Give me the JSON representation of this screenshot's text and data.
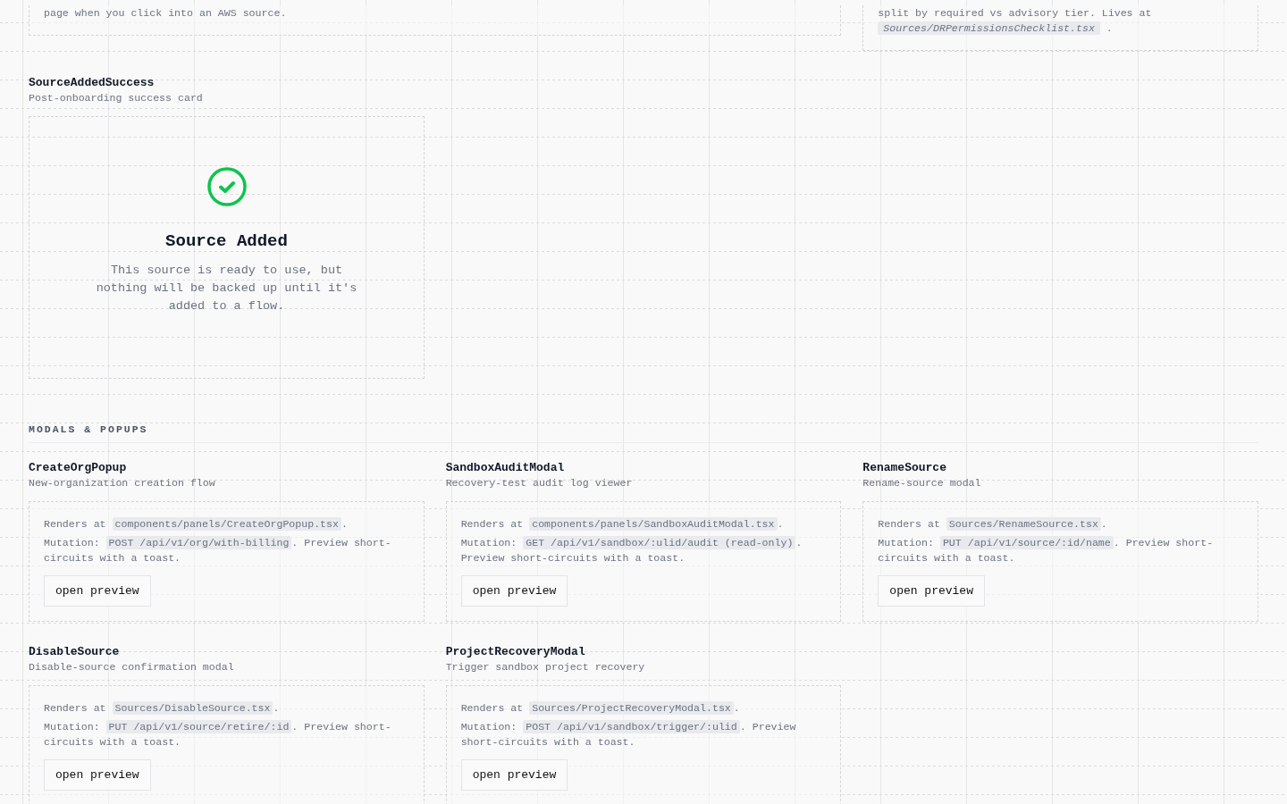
{
  "partial_cards": [
    {
      "wide": true,
      "paragraphs": [
        [
          {
            "kind": "text",
            "text": "page when you click into an AWS source."
          }
        ]
      ]
    },
    {
      "wide": false,
      "paragraphs": [
        [
          {
            "kind": "text",
            "text": "split by required vs advisory tier. Lives at "
          },
          {
            "kind": "italic_code",
            "text": "Sources/DRPermissionsChecklist.tsx"
          },
          {
            "kind": "text",
            "text": " ."
          }
        ]
      ]
    }
  ],
  "success_preview": {
    "name": "SourceAddedSuccess",
    "description": "Post-onboarding success card",
    "card": {
      "title": "Source Added",
      "message": "This source is ready to use, but nothing will be backed up until it's added to a flow."
    }
  },
  "modals_section": {
    "heading": "MODALS & POPUPS",
    "components": [
      {
        "name": "CreateOrgPopup",
        "description": "New-organization creation flow",
        "paragraphs": [
          [
            {
              "kind": "text",
              "text": "Renders at "
            },
            {
              "kind": "code",
              "text": "components/panels/CreateOrgPopup.tsx"
            },
            {
              "kind": "text",
              "text": "."
            }
          ],
          [
            {
              "kind": "text",
              "text": "Mutation: "
            },
            {
              "kind": "code",
              "text": "POST /api/v1/org/with-billing"
            },
            {
              "kind": "text",
              "text": ". Preview short-circuits with a toast."
            }
          ]
        ],
        "button": "open preview"
      },
      {
        "name": "SandboxAuditModal",
        "description": "Recovery-test audit log viewer",
        "paragraphs": [
          [
            {
              "kind": "text",
              "text": "Renders at "
            },
            {
              "kind": "code",
              "text": "components/panels/SandboxAuditModal.tsx"
            },
            {
              "kind": "text",
              "text": "."
            }
          ],
          [
            {
              "kind": "text",
              "text": "Mutation: "
            },
            {
              "kind": "code",
              "text": "GET /api/v1/sandbox/:ulid/audit (read-only)"
            },
            {
              "kind": "text",
              "text": ". Preview short-circuits with a toast."
            }
          ]
        ],
        "button": "open preview"
      },
      {
        "name": "RenameSource",
        "description": "Rename-source modal",
        "paragraphs": [
          [
            {
              "kind": "text",
              "text": "Renders at "
            },
            {
              "kind": "code",
              "text": "Sources/RenameSource.tsx"
            },
            {
              "kind": "text",
              "text": "."
            }
          ],
          [
            {
              "kind": "text",
              "text": "Mutation: "
            },
            {
              "kind": "code",
              "text": "PUT /api/v1/source/:id/name"
            },
            {
              "kind": "text",
              "text": ". Preview short-circuits with a toast."
            }
          ]
        ],
        "button": "open preview"
      },
      {
        "name": "DisableSource",
        "description": "Disable-source confirmation modal",
        "paragraphs": [
          [
            {
              "kind": "text",
              "text": "Renders at "
            },
            {
              "kind": "code",
              "text": "Sources/DisableSource.tsx"
            },
            {
              "kind": "text",
              "text": "."
            }
          ],
          [
            {
              "kind": "text",
              "text": "Mutation: "
            },
            {
              "kind": "code",
              "text": "PUT /api/v1/source/retire/:id"
            },
            {
              "kind": "text",
              "text": ". Preview short-circuits with a toast."
            }
          ]
        ],
        "button": "open preview"
      },
      {
        "name": "ProjectRecoveryModal",
        "description": "Trigger sandbox project recovery",
        "paragraphs": [
          [
            {
              "kind": "text",
              "text": "Renders at "
            },
            {
              "kind": "code",
              "text": "Sources/ProjectRecoveryModal.tsx"
            },
            {
              "kind": "text",
              "text": "."
            }
          ],
          [
            {
              "kind": "text",
              "text": "Mutation: "
            },
            {
              "kind": "code",
              "text": "POST /api/v1/sandbox/trigger/:ulid"
            },
            {
              "kind": "text",
              "text": ". Preview short-circuits with a toast."
            }
          ]
        ],
        "button": "open preview"
      }
    ]
  }
}
